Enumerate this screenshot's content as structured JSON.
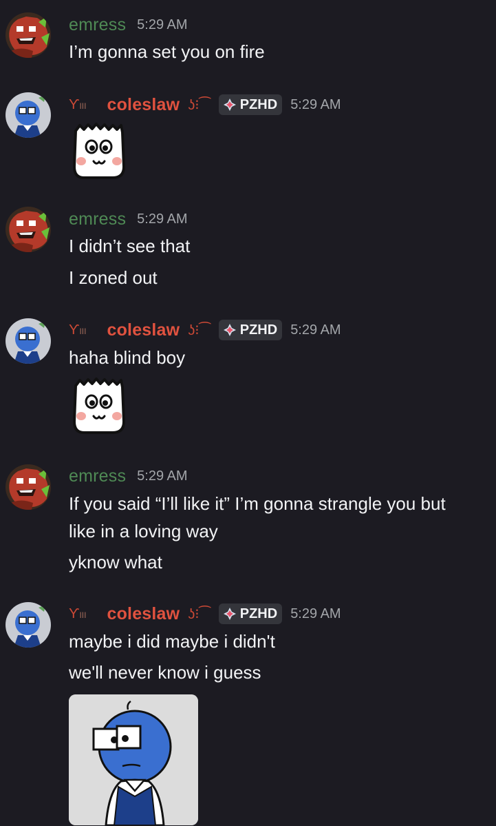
{
  "messages": [
    {
      "user": "emress",
      "time": "5:29 AM",
      "lines": [
        "I’m gonna set you on fire"
      ]
    },
    {
      "user": "coleslaw",
      "tag": "PZHD",
      "time": "5:29 AM",
      "lines": []
    },
    {
      "user": "emress",
      "time": "5:29 AM",
      "lines": [
        "I didn’t see that",
        "I zoned out"
      ]
    },
    {
      "user": "coleslaw",
      "tag": "PZHD",
      "time": "5:29 AM",
      "lines": [
        "haha blind boy"
      ]
    },
    {
      "user": "emress",
      "time": "5:29 AM",
      "lines": [
        "If you said “I’ll like it” I’m gonna strangle you but",
        "like in a loving way",
        "yknow what"
      ]
    },
    {
      "user": "coleslaw",
      "tag": "PZHD",
      "time": "5:29 AM",
      "lines": [
        "maybe i did maybe i didn't",
        "we'll never know i guess"
      ]
    }
  ],
  "colors": {
    "background": "#1c1b22",
    "emress_name": "#4f8a55",
    "coleslaw_name": "#e0523f",
    "timestamp": "#a3a6aa"
  },
  "icons": {
    "tag_icon": "diamond-sparkle-icon",
    "sticker": "white-blob-face-sticker"
  }
}
